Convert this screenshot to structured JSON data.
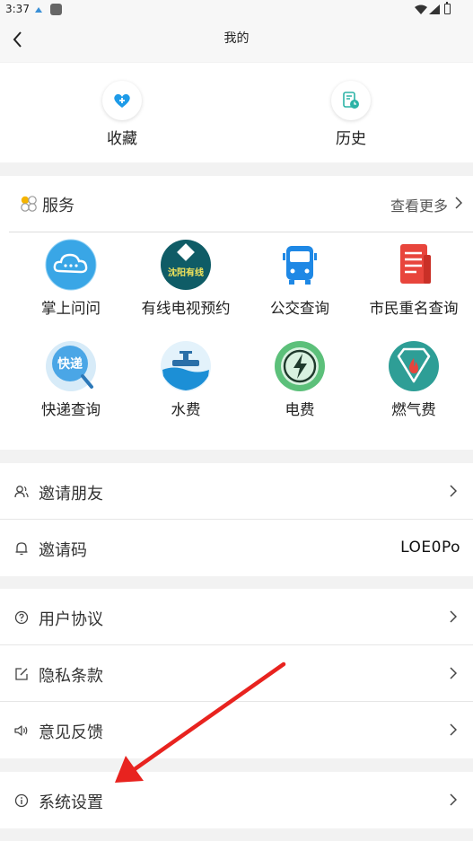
{
  "status_bar": {
    "time": "3:37"
  },
  "header": {
    "title": "我的"
  },
  "quick": [
    {
      "label": "收藏",
      "icon": "heart-icon"
    },
    {
      "label": "历史",
      "icon": "history-icon"
    }
  ],
  "services": {
    "title": "服务",
    "more_label": "查看更多",
    "items": [
      {
        "label": "掌上问问",
        "icon": "cloud-chat-icon"
      },
      {
        "label": "有线电视预约",
        "icon": "cable-tv-icon",
        "icon_text": "沈阳有线"
      },
      {
        "label": "公交查询",
        "icon": "bus-icon"
      },
      {
        "label": "市民重名查询",
        "icon": "document-icon"
      },
      {
        "label": "快递查询",
        "icon": "express-icon",
        "icon_text": "快递"
      },
      {
        "label": "水费",
        "icon": "water-icon"
      },
      {
        "label": "电费",
        "icon": "electricity-icon"
      },
      {
        "label": "燃气费",
        "icon": "gas-icon"
      }
    ]
  },
  "settings_group1": [
    {
      "label": "邀请朋友",
      "icon": "user-icon"
    },
    {
      "label": "邀请码",
      "icon": "bell-icon",
      "value": "LOE0Po"
    }
  ],
  "settings_group2": [
    {
      "label": "用户协议",
      "icon": "question-icon"
    },
    {
      "label": "隐私条款",
      "icon": "edit-icon"
    },
    {
      "label": "意见反馈",
      "icon": "speaker-icon"
    }
  ],
  "settings_group3": [
    {
      "label": "系统设置",
      "icon": "info-icon"
    }
  ],
  "colors": {
    "accent_blue": "#1e9be8",
    "arrow_red": "#e8231f"
  }
}
